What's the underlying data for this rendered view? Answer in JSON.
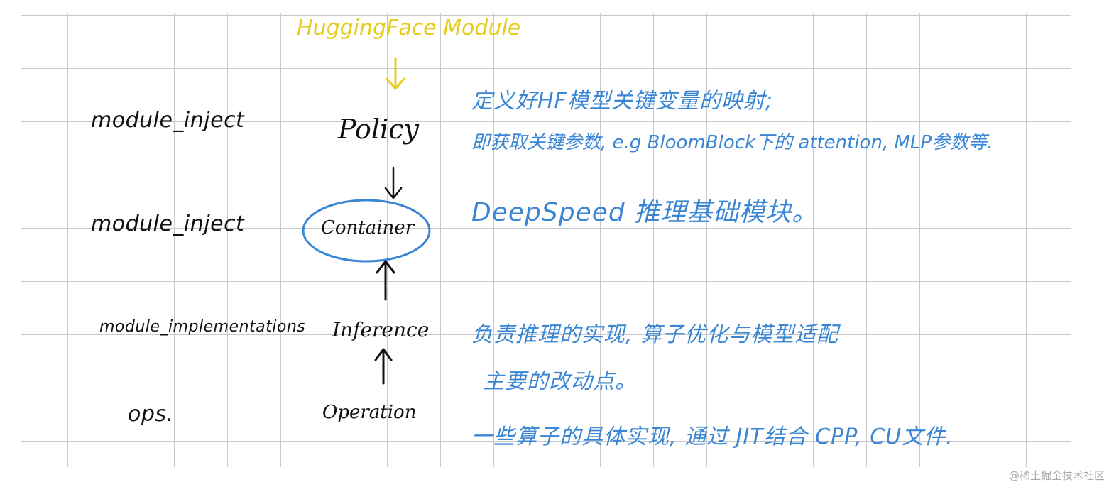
{
  "header": {
    "title": "HuggingFace Module"
  },
  "layers": [
    {
      "left": "module_inject",
      "center": "Policy",
      "note_lines": [
        "定义好HF模型关键变量的映射;",
        "即获取关键参数, e.g BloomBlock下的 attention, MLP参数等."
      ]
    },
    {
      "left": "module_inject",
      "center": "Container",
      "note_lines": [
        "DeepSpeed 推理基础模块。"
      ]
    },
    {
      "left": "module_implementations",
      "center": "Inference",
      "note_lines": [
        "负责推理的实现, 算子优化与模型适配",
        "主要的改动点。"
      ]
    },
    {
      "left": "ops.",
      "center": "Operation",
      "note_lines": [
        "一些算子的具体实现, 通过 JIT结合 CPP, CU文件."
      ]
    }
  ],
  "watermark": "@稀土掘金技术社区",
  "colors": {
    "accent_yellow": "#e8cc1c",
    "note_blue": "#3a86d4",
    "ink": "#111111",
    "grid": "#c9c9c9"
  }
}
